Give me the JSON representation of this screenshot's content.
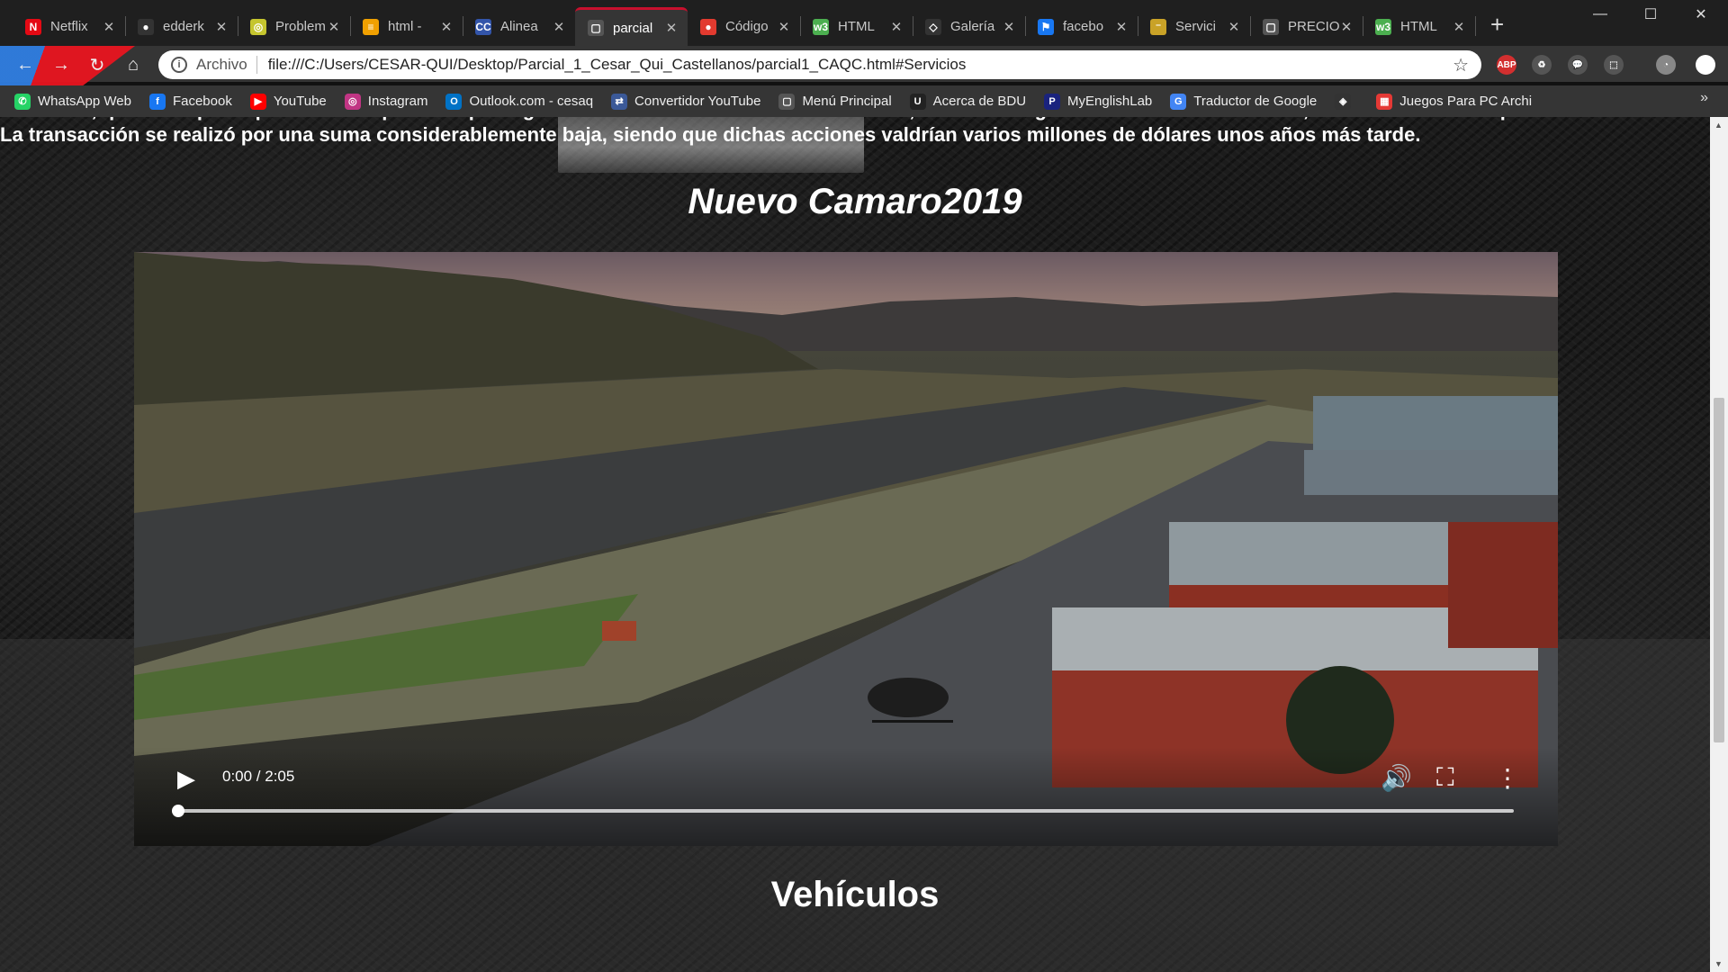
{
  "browser": {
    "tabs": [
      {
        "title": "Netflix",
        "icon": "netflix-icon",
        "color": "#e50914",
        "glyph": "N",
        "active": false
      },
      {
        "title": "edderk",
        "icon": "github-icon",
        "color": "#333333",
        "glyph": "●",
        "active": false
      },
      {
        "title": "Problem",
        "icon": "problem-icon",
        "color": "#c5c52e",
        "glyph": "◎",
        "active": false
      },
      {
        "title": "html -",
        "icon": "stack-icon",
        "color": "#f0a000",
        "glyph": "≡",
        "active": false
      },
      {
        "title": "Alinea",
        "icon": "w3c-icon",
        "color": "#3355aa",
        "glyph": "CC",
        "active": false
      },
      {
        "title": "parcial",
        "icon": "file-icon",
        "color": "#555555",
        "glyph": "▢",
        "active": true
      },
      {
        "title": "Código",
        "icon": "code-icon",
        "color": "#e23a2f",
        "glyph": "●",
        "active": false
      },
      {
        "title": "HTML",
        "icon": "html-icon",
        "color": "#4caf50",
        "glyph": "w3",
        "active": false
      },
      {
        "title": "Galería",
        "icon": "gallery-icon",
        "color": "#333333",
        "glyph": "◇",
        "active": false
      },
      {
        "title": "facebo",
        "icon": "flag-icon",
        "color": "#1877f2",
        "glyph": "⚑",
        "active": false
      },
      {
        "title": "Servici",
        "icon": "chevrolet-icon",
        "color": "#c9a227",
        "glyph": "⁻",
        "active": false
      },
      {
        "title": "PRECIO",
        "icon": "file-icon",
        "color": "#555555",
        "glyph": "▢",
        "active": false
      },
      {
        "title": "HTML",
        "icon": "html-icon",
        "color": "#4caf50",
        "glyph": "w3",
        "active": false
      }
    ],
    "new_tab": "+",
    "window_controls": {
      "minimize": "—",
      "maximize": "☐",
      "close": "✕"
    },
    "address": {
      "security_label": "Archivo",
      "url": "file:///C:/Users/CESAR-QUI/Desktop/Parcial_1_Cesar_Qui_Castellanos/parcial1_CAQC.html#Servicios"
    },
    "extensions": [
      {
        "name": "adblock-icon",
        "glyph": "ABP",
        "color": "#d32f2f"
      },
      {
        "name": "recycle-icon",
        "glyph": "♻",
        "color": "#555555"
      },
      {
        "name": "chat-icon",
        "glyph": "💬",
        "color": "#555555"
      },
      {
        "name": "pdf-icon",
        "glyph": "⬚",
        "color": "#555555"
      },
      {
        "name": "account-icon",
        "glyph": "◔",
        "color": "#888888"
      }
    ],
    "bookmarks": [
      {
        "label": "WhatsApp Web",
        "icon": "whatsapp-icon",
        "color": "#25d366",
        "glyph": "✆"
      },
      {
        "label": "Facebook",
        "icon": "facebook-icon",
        "color": "#1877f2",
        "glyph": "f"
      },
      {
        "label": "YouTube",
        "icon": "youtube-icon",
        "color": "#ff0000",
        "glyph": "▶"
      },
      {
        "label": "Instagram",
        "icon": "instagram-icon",
        "color": "#c13584",
        "glyph": "◎"
      },
      {
        "label": "Outlook.com - cesaq",
        "icon": "outlook-icon",
        "color": "#0072c6",
        "glyph": "O"
      },
      {
        "label": "Convertidor YouTube",
        "icon": "converter-icon",
        "color": "#3b5998",
        "glyph": "⇄"
      },
      {
        "label": "Menú Principal",
        "icon": "file-icon",
        "color": "#555555",
        "glyph": "▢"
      },
      {
        "label": "Acerca de BDU",
        "icon": "bdu-icon",
        "color": "#222222",
        "glyph": "U"
      },
      {
        "label": "MyEnglishLab",
        "icon": "pearson-icon",
        "color": "#1a237e",
        "glyph": "P"
      },
      {
        "label": "Traductor de Google",
        "icon": "translate-icon",
        "color": "#4285f4",
        "glyph": "G"
      },
      {
        "label": "",
        "icon": "ghost-icon",
        "color": "#333333",
        "glyph": "◈"
      },
      {
        "label": "Juegos Para PC Archi",
        "icon": "games-icon",
        "color": "#e53935",
        "glyph": "▦"
      }
    ],
    "bookmarks_more": "»"
  },
  "page": {
    "paragraph": "Chevrolet, quien no quiso que su marca perdiese prestigio con este desarrollo. Ante esta actitud, Durant le sugirió la salida de la sociedad, ofreciéndole la compra de sus acciones. La transacción se realizó por una suma considerablemente baja, siendo que dichas acciones valdrían varios millones de dólares unos años más tarde.",
    "video_title": "Nuevo Camaro2019",
    "video": {
      "time": "0:00 / 2:05",
      "progress": 0
    },
    "section_heading": "Vehículos"
  }
}
